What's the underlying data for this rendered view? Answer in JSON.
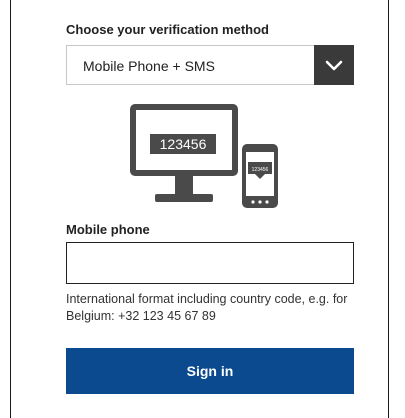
{
  "verification": {
    "label": "Choose your verification method",
    "selected_value": "Mobile Phone + SMS"
  },
  "illustration": {
    "monitor_code": "123456",
    "phone_code": "123456"
  },
  "mobile_phone": {
    "label": "Mobile phone",
    "value": "",
    "help_text": "International format including country code, e.g. for Belgium: +32 123 45 67 89"
  },
  "actions": {
    "sign_in_label": "Sign in"
  },
  "colors": {
    "primary_button": "#0b4a8f",
    "dropdown_button": "#3a3a3a",
    "illustration_gray": "#4a4a4a"
  },
  "icons": {
    "dropdown": "chevron-down-icon"
  }
}
